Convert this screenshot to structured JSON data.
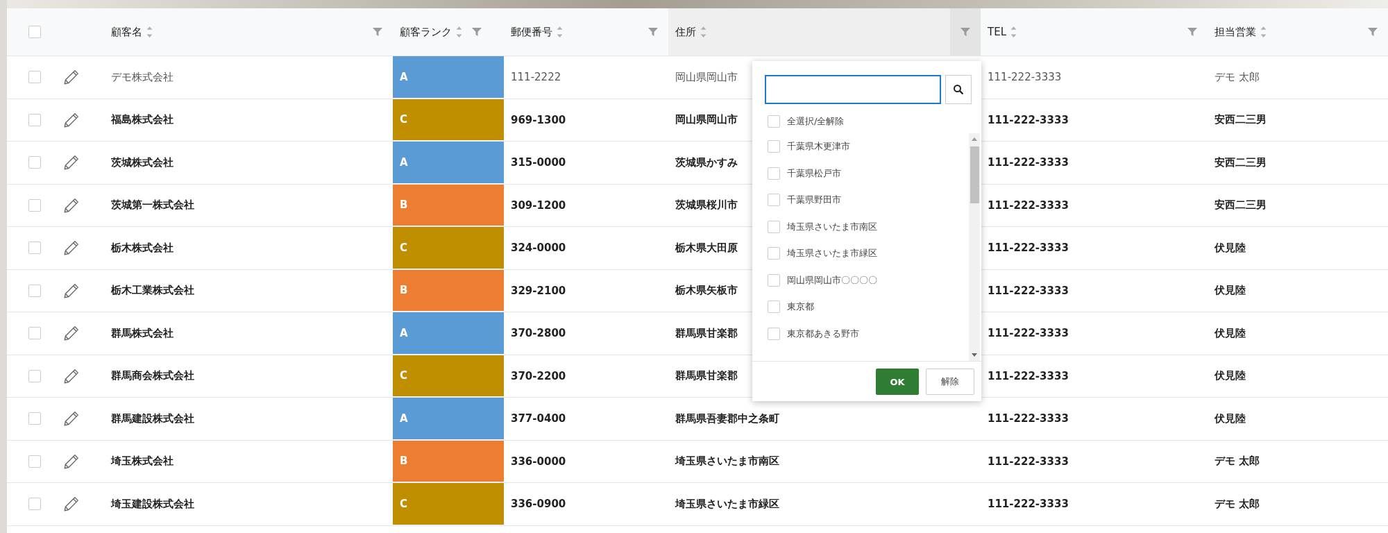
{
  "table": {
    "header_checkbox": {
      "checked": false
    },
    "columns": [
      {
        "label": "顧客名",
        "active": false
      },
      {
        "label": "顧客ランク",
        "active": false
      },
      {
        "label": "郵便番号",
        "active": false
      },
      {
        "label": "住所",
        "active": true
      },
      {
        "label": "TEL",
        "active": false
      },
      {
        "label": "担当営業",
        "active": false
      }
    ],
    "rows": [
      {
        "checked": false,
        "bold": false,
        "name": "デモ株式会社",
        "rank": "A",
        "color": "#5b9bd5",
        "zip": "111-2222",
        "address": "岡山県岡山市",
        "tel": "111-222-3333",
        "rep": "デモ 太郎"
      },
      {
        "checked": false,
        "bold": true,
        "name": "福島株式会社",
        "rank": "C",
        "color": "#bf8f00",
        "zip": "969-1300",
        "address": "岡山県岡山市",
        "tel": "111-222-3333",
        "rep": "安西二三男"
      },
      {
        "checked": false,
        "bold": true,
        "name": "茨城株式会社",
        "rank": "A",
        "color": "#5b9bd5",
        "zip": "315-0000",
        "address": "茨城県かすみ",
        "tel": "111-222-3333",
        "rep": "安西二三男"
      },
      {
        "checked": false,
        "bold": true,
        "name": "茨城第一株式会社",
        "rank": "B",
        "color": "#ed7d31",
        "zip": "309-1200",
        "address": "茨城県桜川市",
        "tel": "111-222-3333",
        "rep": "安西二三男"
      },
      {
        "checked": false,
        "bold": true,
        "name": "栃木株式会社",
        "rank": "C",
        "color": "#bf8f00",
        "zip": "324-0000",
        "address": "栃木県大田原",
        "tel": "111-222-3333",
        "rep": "伏見陸"
      },
      {
        "checked": false,
        "bold": true,
        "name": "栃木工業株式会社",
        "rank": "B",
        "color": "#ed7d31",
        "zip": "329-2100",
        "address": "栃木県矢板市",
        "tel": "111-222-3333",
        "rep": "伏見陸"
      },
      {
        "checked": false,
        "bold": true,
        "name": "群馬株式会社",
        "rank": "A",
        "color": "#5b9bd5",
        "zip": "370-2800",
        "address": "群馬県甘楽郡",
        "tel": "111-222-3333",
        "rep": "伏見陸"
      },
      {
        "checked": false,
        "bold": true,
        "name": "群馬商会株式会社",
        "rank": "C",
        "color": "#bf8f00",
        "zip": "370-2200",
        "address": "群馬県甘楽郡",
        "tel": "111-222-3333",
        "rep": "伏見陸"
      },
      {
        "checked": false,
        "bold": true,
        "name": "群馬建設株式会社",
        "rank": "A",
        "color": "#5b9bd5",
        "zip": "377-0400",
        "address": "群馬県吾妻郡中之条町",
        "tel": "111-222-3333",
        "rep": "伏見陸"
      },
      {
        "checked": false,
        "bold": true,
        "name": "埼玉株式会社",
        "rank": "B",
        "color": "#ed7d31",
        "zip": "336-0000",
        "address": "埼玉県さいたま市南区",
        "tel": "111-222-3333",
        "rep": "デモ 太郎"
      },
      {
        "checked": false,
        "bold": true,
        "name": "埼玉建設株式会社",
        "rank": "C",
        "color": "#bf8f00",
        "zip": "336-0900",
        "address": "埼玉県さいたま市緑区",
        "tel": "111-222-3333",
        "rep": "デモ 太郎"
      }
    ]
  },
  "filter_popup": {
    "select_all": {
      "label": "全選択/全解除",
      "checked": false
    },
    "options": [
      {
        "label": "千葉県木更津市",
        "checked": false
      },
      {
        "label": "千葉県松戸市",
        "checked": false
      },
      {
        "label": "千葉県野田市",
        "checked": false
      },
      {
        "label": "埼玉県さいたま市南区",
        "checked": false
      },
      {
        "label": "埼玉県さいたま市緑区",
        "checked": false
      },
      {
        "label": "岡山県岡山市〇〇〇〇",
        "checked": false
      },
      {
        "label": "東京都",
        "checked": false
      },
      {
        "label": "東京都あきる野市",
        "checked": false
      }
    ],
    "buttons": [
      "OK",
      "解除"
    ]
  }
}
